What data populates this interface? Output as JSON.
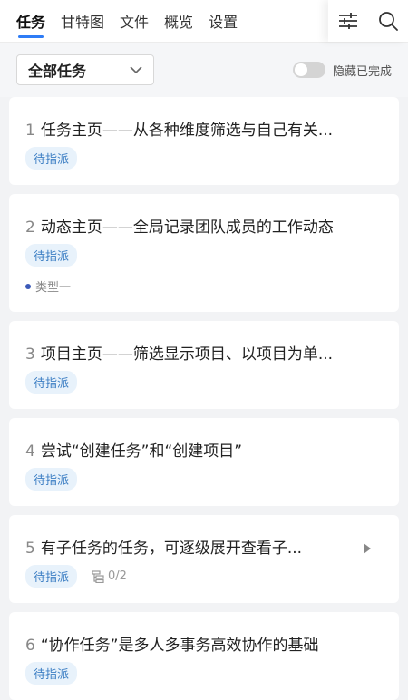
{
  "nav": {
    "tabs": [
      {
        "label": "任务"
      },
      {
        "label": "甘特图"
      },
      {
        "label": "文件"
      },
      {
        "label": "概览"
      },
      {
        "label": "设置"
      }
    ],
    "filter_icon": "filter-sliders-icon",
    "search_icon": "search-icon"
  },
  "filter": {
    "select_value": "全部任务",
    "hide_completed_label": "隐藏已完成",
    "hide_completed_on": false
  },
  "tasks": [
    {
      "num": "1",
      "title": "任务主页——从各种维度筛选与自己有关...",
      "badge": "待指派"
    },
    {
      "num": "2",
      "title": "动态主页——全局记录团队成员的工作动态",
      "badge": "待指派",
      "type": "类型一"
    },
    {
      "num": "3",
      "title": "项目主页——筛选显示项目、以项目为单...",
      "badge": "待指派"
    },
    {
      "num": "4",
      "title": "尝试“创建任务”和“创建项目”",
      "badge": "待指派"
    },
    {
      "num": "5",
      "title": "有子任务的任务，可逐级展开查看子...",
      "badge": "待指派",
      "subtasks": "0/2"
    },
    {
      "num": "6",
      "title": "“协作任务”是多人多事务高效协作的基础",
      "badge": "待指派"
    }
  ],
  "colors": {
    "accent": "#2e7cf6",
    "badge_bg": "#e8f2fb",
    "badge_text": "#3d7fc4",
    "type_dot": "#3b5ab8"
  }
}
